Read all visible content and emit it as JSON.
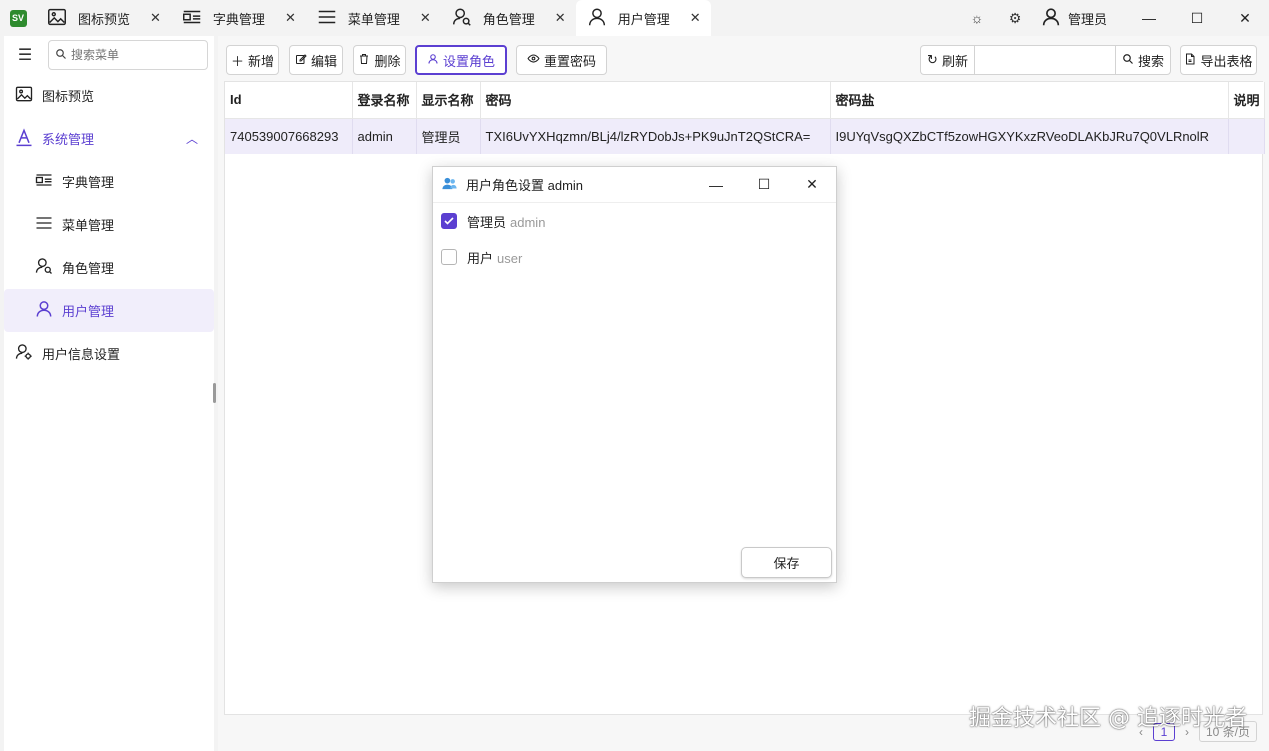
{
  "app": {
    "logo_text": "SV"
  },
  "tabs": [
    {
      "label": "图标预览",
      "icon": "image-icon",
      "active": false
    },
    {
      "label": "字典管理",
      "icon": "dictionary-icon",
      "active": false
    },
    {
      "label": "菜单管理",
      "icon": "menu-lines-icon",
      "active": false
    },
    {
      "label": "角色管理",
      "icon": "role-search-icon",
      "active": false
    },
    {
      "label": "用户管理",
      "icon": "user-icon",
      "active": true
    }
  ],
  "titlebar": {
    "user_name": "管理员"
  },
  "sidebar": {
    "search_placeholder": "搜索菜单",
    "items": [
      {
        "label": "图标预览"
      },
      {
        "label": "系统管理"
      },
      {
        "label": "字典管理"
      },
      {
        "label": "菜单管理"
      },
      {
        "label": "角色管理"
      },
      {
        "label": "用户管理"
      },
      {
        "label": "用户信息设置"
      }
    ]
  },
  "toolbar": {
    "add_label": "新增",
    "edit_label": "编辑",
    "delete_label": "删除",
    "set_role_label": "设置角色",
    "reset_pwd_label": "重置密码",
    "refresh_label": "刷新",
    "search_value": "",
    "search_label": "搜索",
    "export_label": "导出表格"
  },
  "table": {
    "columns": [
      "Id",
      "登录名称",
      "显示名称",
      "密码",
      "密码盐",
      "说明"
    ],
    "rows": [
      [
        "740539007668293",
        "admin",
        "管理员",
        "TXI6UvYXHqzmn/BLj4/lzRYDobJs+PK9uJnT2QStCRA=",
        "I9UYqVsgQXZbCTf5zowHGXYKxzRVeoDLAKbJRu7Q0VLRnolR",
        ""
      ]
    ]
  },
  "pager": {
    "page": "1",
    "page_size": "10 条/页"
  },
  "dialog": {
    "title": "用户角色设置 admin",
    "roles": [
      {
        "name": "管理员",
        "code": "admin",
        "checked": true
      },
      {
        "name": "用户",
        "code": "user",
        "checked": false
      }
    ],
    "save_label": "保存"
  },
  "watermark": "掘金技术社区 @ 追逐时光者",
  "colors": {
    "accent": "#5b3fd1",
    "selected_row": "#efecfa",
    "logo": "#2e8b2e"
  }
}
